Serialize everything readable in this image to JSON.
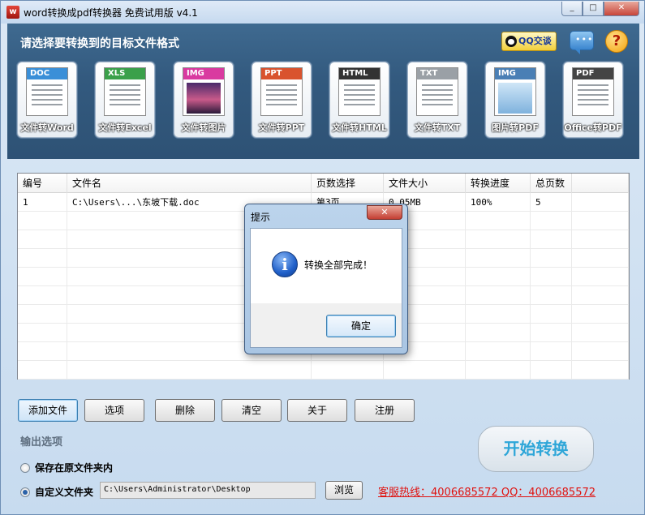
{
  "window": {
    "title": "word转换成pdf转换器 免费试用版 v4.1",
    "controls": {
      "minimize": "_",
      "maximize": "□",
      "close": "✕"
    }
  },
  "header": {
    "title": "请选择要转换到的目标文件格式",
    "qq_badge": "QQ交谈",
    "help": "?"
  },
  "formats": [
    {
      "tag": "DOC",
      "label": "文件转Word",
      "color": "#3a8fd8"
    },
    {
      "tag": "XLS",
      "label": "文件转Excel",
      "color": "#3aa04a"
    },
    {
      "tag": "IMG",
      "label": "文件转图片",
      "color": "#d93aa0"
    },
    {
      "tag": "PPT",
      "label": "文件转PPT",
      "color": "#d9532e"
    },
    {
      "tag": "HTML",
      "label": "文件转HTML",
      "color": "#333333"
    },
    {
      "tag": "TXT",
      "label": "文件转TXT",
      "color": "#9aa0a6"
    },
    {
      "tag": "IMG",
      "label": "图片转PDF",
      "color": "#4a7fb5"
    },
    {
      "tag": "PDF",
      "label": "Office转PDF",
      "color": "#444444"
    }
  ],
  "table": {
    "columns": [
      "编号",
      "文件名",
      "页数选择",
      "文件大小",
      "转换进度",
      "总页数"
    ],
    "rows": [
      [
        "1",
        "C:\\Users\\...\\东坡下载.doc",
        "第3页",
        "0.05MB",
        "100%",
        "5"
      ]
    ]
  },
  "dialog": {
    "title": "提示",
    "close": "✕",
    "message": "转换全部完成！",
    "ok": "确定"
  },
  "actions": [
    "添加文件",
    "选项",
    "删除",
    "清空",
    "关于",
    "注册"
  ],
  "output": {
    "title": "输出选项",
    "option_original": "保存在原文件夹内",
    "option_custom": "自定义文件夹",
    "path": "C:\\Users\\Administrator\\Desktop",
    "browse": "浏览"
  },
  "hotline": "客服热线：4006685572 QQ：4006685572",
  "start_button": "开始转换"
}
